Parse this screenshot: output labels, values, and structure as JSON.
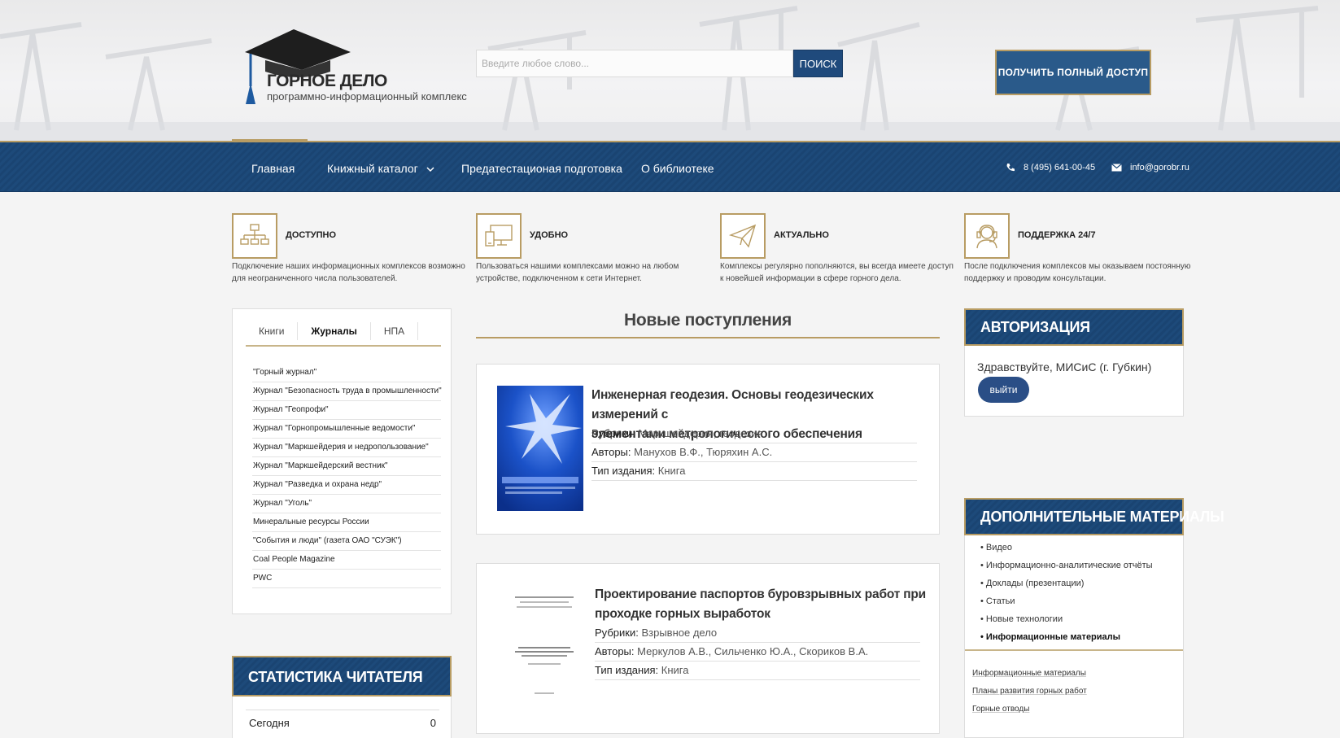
{
  "logo": {
    "title": "ГОРНОЕ ДЕЛО",
    "subtitle": "программно-информационный комплекс",
    "icon": "graduation-cap-icon"
  },
  "search": {
    "placeholder": "Введите любое слово...",
    "value": "",
    "button": "ПОИСК"
  },
  "access_button": "ПОЛУЧИТЬ ПОЛНЫЙ ДОСТУП",
  "nav": {
    "items": [
      {
        "label": "Главная"
      },
      {
        "label": "Книжный каталог",
        "has_dropdown": true
      },
      {
        "label": "Предатестационая подготовка"
      },
      {
        "label": "О библиотеке"
      }
    ],
    "phone": "8 (495) 641-00-45",
    "email": "info@gorobr.ru"
  },
  "features": [
    {
      "title": "ДОСТУПНО",
      "icon": "network-icon",
      "text": "Подключение наших информационных комплексов возможно для неограниченного числа пользователей."
    },
    {
      "title": "УДОБНО",
      "icon": "devices-icon",
      "text": "Пользоваться нашими комплексами можно на любом устройстве, подключенном к сети Интернет."
    },
    {
      "title": "АКТУАЛЬНО",
      "icon": "paper-plane-icon",
      "text": "Комплексы регулярно пополняются, вы всегда имеете доступ к новейшей информации в сфере горного дела."
    },
    {
      "title": "ПОДДЕРЖКА 24/7",
      "icon": "support-headset-icon",
      "text": "После подключения комплексов мы оказываем постоянную поддержку и проводим консультации."
    }
  ],
  "tabs": {
    "items": [
      "Книги",
      "Журналы",
      "НПА"
    ],
    "active": "Журналы"
  },
  "journals": [
    "\"Горный журнал\"",
    "Журнал \"Безопасность труда в промышленности\"",
    "Журнал \"Геопрофи\"",
    "Журнал \"Горнопромышленные ведомости\"",
    "Журнал \"Маркшейдерия и недропользование\"",
    "Журнал \"Маркшейдерский вестник\"",
    "Журнал \"Разведка и охрана недр\"",
    "Журнал \"Уголь\"",
    "Минеральные ресурсы России",
    "\"События и люди\" (газета ОАО \"СУЭК\")",
    "Coal People Magazine",
    "PWC"
  ],
  "stats": {
    "title": "СТАТИСТИКА ЧИТАТЕЛЯ",
    "rows": [
      {
        "label": "Сегодня",
        "value": "0"
      }
    ]
  },
  "new_arrivals": {
    "title": "Новые поступления",
    "labels": {
      "rubrics": "Рубрики:",
      "authors": "Авторы:",
      "type": "Тип издания:"
    },
    "books": [
      {
        "title_line1": "Инженерная геодезия. Основы геодезических измерений с",
        "title_line2": "элементами метрологического обеспечения",
        "rubrics": "Маркшейдерия, геодезия",
        "authors": "Манухов В.Ф., Тюряхин А.С.",
        "type": "Книга"
      },
      {
        "title_line1": "Проектирование паспортов буровзрывных работ при",
        "title_line2": "проходке горных выработок",
        "rubrics": "Взрывное дело",
        "authors": "Меркулов А.В., Сильченко Ю.А., Скориков В.А.",
        "type": "Книга"
      }
    ]
  },
  "auth": {
    "title": "АВТОРИЗАЦИЯ",
    "greeting": "Здравствуйте, МИСиС (г. Губкин)",
    "logout": "выйти"
  },
  "extra": {
    "title": "ДОПОЛНИТЕЛЬНЫЕ МАТЕРИАЛЫ",
    "items": [
      "• Видео",
      "• Информационно-аналитические отчёты",
      "• Доклады (презентации)",
      "• Статьи",
      "• Новые технологии",
      "• Информационные материалы"
    ],
    "active_index": 5,
    "sub_items": [
      "Информационные материалы",
      "Планы развития горных работ",
      "Горные отводы"
    ]
  },
  "colors": {
    "brand_blue": "#1d4a7a",
    "gold": "#b89c63"
  }
}
